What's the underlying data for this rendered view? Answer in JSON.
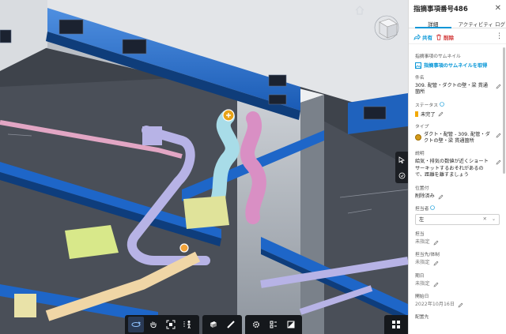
{
  "viewport": {
    "icons": {
      "home": "home-icon",
      "viewcube": "viewcube-icon",
      "select": "cursor-icon",
      "markup": "markup-icon",
      "markers": [
        {
          "name": "plus-marker",
          "color": "#e8a317"
        },
        {
          "name": "point-marker",
          "color": "#f2a33a"
        }
      ]
    },
    "toolbar": {
      "groups": [
        [
          "orbit-icon",
          "pan-icon",
          "fit-to-view-icon",
          "first-person-icon"
        ],
        [
          "section-box-icon",
          "measure-icon"
        ],
        [
          "settings-icon",
          "model-browser-icon",
          "properties-icon"
        ]
      ]
    },
    "colors": {
      "beam": "#1565c0",
      "duct_cyan": "#a8dce8",
      "duct_pink": "#d98fc4",
      "duct_lavender": "#b7b3e6",
      "equipment_yellow": "#d8e88a"
    }
  },
  "panel": {
    "title": "指摘事項番号486",
    "close_icon": "close-icon",
    "tabs": [
      {
        "label": "詳細",
        "active": true
      },
      {
        "label": "アクティビティ ログ",
        "active": false
      }
    ],
    "actions": {
      "share_label": "共有",
      "delete_label": "削除",
      "more_icon": "more-vertical-icon"
    },
    "fields": {
      "thumbnail": {
        "label": "指摘事項のサムネイル",
        "link": "指摘事項のサムネイルを取得"
      },
      "title": {
        "label": "件名",
        "value": "309. 配管・ダクトの壁・梁  貫通箇所"
      },
      "status": {
        "label": "ステータス",
        "value": "未完了",
        "color": "#f2a900"
      },
      "type": {
        "label": "タイプ",
        "value": "ダクト・配管 - 309. 配管・ダクトの壁・梁  貫通箇所"
      },
      "description": {
        "label": "説明",
        "value": "給気・排気の数値が近くショートサーキットするおそれがあるので、距離を離すましょう"
      },
      "placement": {
        "label": "位置付",
        "value": "削除済み"
      },
      "assigned_to": {
        "label": "担当者",
        "value": "左"
      },
      "assignee": {
        "label": "担当",
        "value": "未指定"
      },
      "assignee_company": {
        "label": "担当先/体制",
        "value": "未指定"
      },
      "due_date": {
        "label": "期日",
        "value": "未指定"
      },
      "start_date": {
        "label": "開始日",
        "value": "2022年10月16日"
      },
      "location": {
        "label": "配置先",
        "value": ""
      }
    }
  }
}
